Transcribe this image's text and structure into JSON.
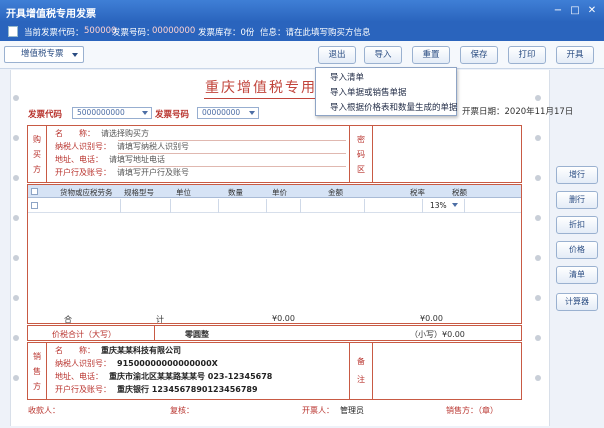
{
  "window": {
    "title": "开具增值税专用发票",
    "controls": [
      "−",
      "□",
      "✕"
    ]
  },
  "info_bar": {
    "segments": [
      {
        "text": "当前发票代码：",
        "red": false
      },
      {
        "text": "500000",
        "red": true
      },
      {
        "text": "发票号码：",
        "red": false
      },
      {
        "text": "00000000",
        "red": true
      },
      {
        "text": "发票库存：0份",
        "red": false
      },
      {
        "text": "信息：请在此填写购买方信息",
        "red": false
      }
    ]
  },
  "toolbar": {
    "invoice_type": "增值税专票",
    "buttons": [
      "退出",
      "导入",
      "重置",
      "保存",
      "打印",
      "开具"
    ]
  },
  "import_menu": {
    "items": [
      "导入清单",
      "导入单据或销售单据",
      "导入根据价格表和数量生成的单据"
    ]
  },
  "invoice": {
    "title": "重庆增值税专用发票",
    "type_label": "发票代码",
    "type_value": "5000000000",
    "number_label": "发票号码",
    "number_value": "00000000",
    "date": "开票日期：2020年11月17日"
  },
  "buyer": {
    "side_label": [
      "购",
      "买",
      "方"
    ],
    "rows": [
      {
        "label": "名　　称：",
        "value": "请选择购买方"
      },
      {
        "label": "纳税人识别号：",
        "value": "请填写纳税人识别号"
      },
      {
        "label": "地址、电话：",
        "value": "请填写地址电话"
      },
      {
        "label": "开户行及账号：",
        "value": "请填写开户行及账号"
      }
    ],
    "pwd_label": [
      "密",
      "码",
      "区"
    ]
  },
  "goods_table": {
    "headers": [
      "货物或应税劳务",
      "规格型号",
      "单位",
      "数量",
      "单价",
      "金额",
      "税率",
      "税额"
    ],
    "first_row": {
      "tax_rate": "13%"
    }
  },
  "totals": {
    "total_label": "合",
    "total_label2": "计",
    "amount": "¥0.00",
    "tax": "¥0.00",
    "price_tax_label": "价税合计（大写）",
    "price_tax_words": "零圆整",
    "price_tax_small": "（小写）¥0.00"
  },
  "seller": {
    "side_label": [
      "销",
      "售",
      "方"
    ],
    "rows": [
      {
        "label": "名　　称：",
        "value": "重庆某某科技有限公司"
      },
      {
        "label": "纳税人识别号：",
        "value": "91500000000000000X"
      },
      {
        "label": "地址、电话：",
        "value": "重庆市渝北区某某路某某号 023-12345678"
      },
      {
        "label": "开户行及账号：",
        "value": "重庆银行 1234567890123456789"
      }
    ],
    "note_label": [
      "备",
      "注"
    ]
  },
  "side_buttons": [
    "增行",
    "删行",
    "折扣",
    "价格",
    "清单",
    "计算器"
  ],
  "footer": {
    "payee_label": "收款人：",
    "reviewer_label": "复核：",
    "drawer_label": "开票人：",
    "drawer_value": "管理员",
    "seller_label": "销售方：（章）"
  }
}
